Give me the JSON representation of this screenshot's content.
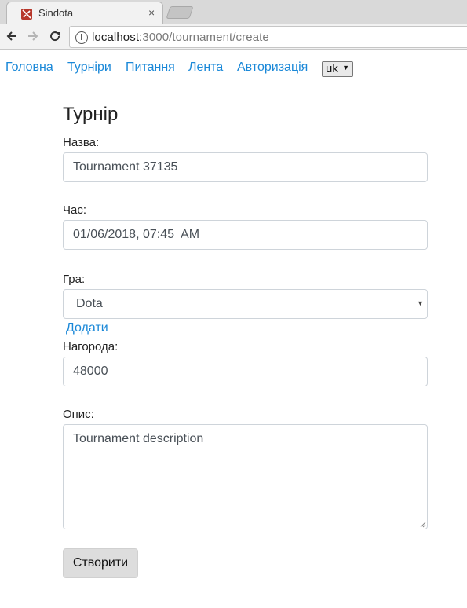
{
  "browser": {
    "tab_title": "Sindota",
    "tab_close": "×",
    "url_host": "localhost",
    "url_path": ":3000/tournament/create"
  },
  "nav": {
    "links": [
      "Головна",
      "Турніри",
      "Питання",
      "Лента",
      "Авторизація"
    ],
    "language": "uk"
  },
  "form": {
    "title": "Турнір",
    "name_label": "Назва:",
    "name_value": "Tournament 37135",
    "time_label": "Час:",
    "time_value": "01/06/2018, 07:45  AM",
    "game_label": "Гра:",
    "game_value": "Dota",
    "add_link": "Додати",
    "prize_label": "Нагорода:",
    "prize_value": "48000",
    "description_label": "Опис:",
    "description_value": "Tournament description",
    "submit_label": "Створити"
  },
  "colors": {
    "link": "#1a88d8",
    "favicon": "#b7372b"
  },
  "icons": [
    "favicon-icon",
    "close-icon",
    "back-arrow-icon",
    "forward-arrow-icon",
    "reload-icon",
    "info-icon",
    "chevron-down-icon"
  ]
}
